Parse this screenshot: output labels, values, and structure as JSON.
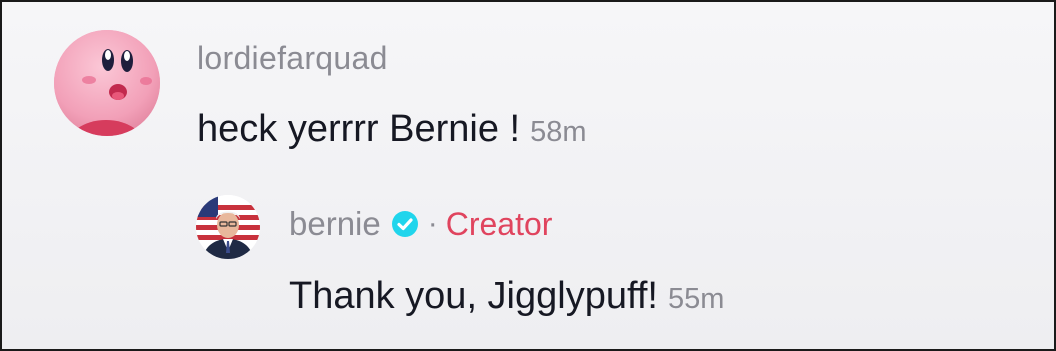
{
  "comment": {
    "username": "lordiefarquad",
    "text": "heck yerrrr Bernie !",
    "time": "58m",
    "avatar_icon": "kirby-avatar"
  },
  "reply": {
    "username": "bernie",
    "verified_icon": "verified-check-icon",
    "separator": "·",
    "badge": "Creator",
    "text": "Thank you, Jigglypuff!",
    "time": "55m",
    "avatar_icon": "bernie-avatar"
  },
  "colors": {
    "background": "#f1f1f3",
    "text_primary": "#161823",
    "text_secondary": "#8b8b93",
    "creator_badge": "#e0445e",
    "verified": "#20d5ec"
  }
}
